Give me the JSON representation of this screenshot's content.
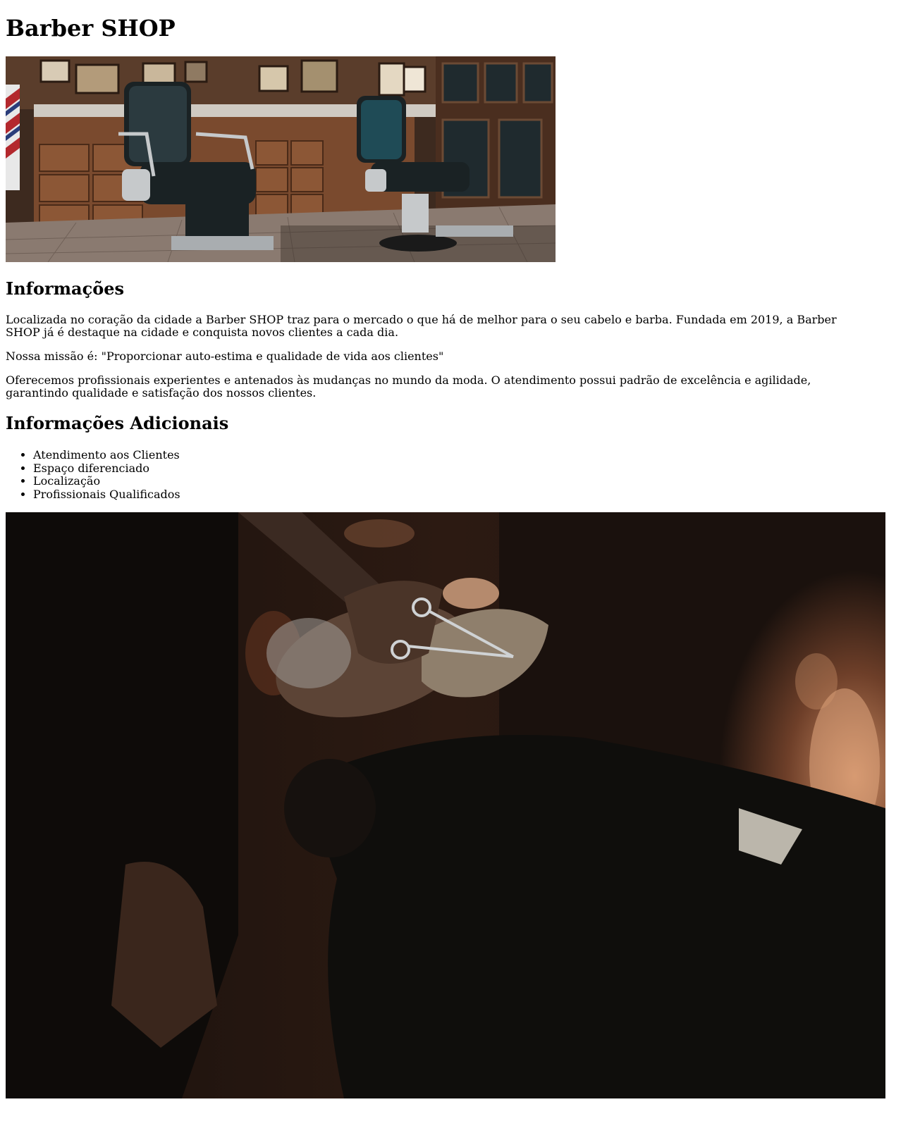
{
  "page": {
    "title": "Barber SHOP"
  },
  "hero_image": {
    "description_icon": "barbershop-interior-photo"
  },
  "info": {
    "heading": "Informações",
    "paragraph_1": "Localizada no coração da cidade a Barber SHOP traz para o mercado o que há de melhor para o seu cabelo e barba. Fundada em 2019, a Barber SHOP já é destaque na cidade e conquista novos clientes a cada dia.",
    "paragraph_2": "Nossa missão é: \"Proporcionar auto-estima e qualidade de vida aos clientes\"",
    "paragraph_3": "Oferecemos profissionais experientes e antenados às mudanças no mundo da moda. O atendimento possui padrão de excelência e agilidade, garantindo qualidade e satisfação dos nossos clientes."
  },
  "additional": {
    "heading": "Informações Adicionais",
    "items": [
      "Atendimento aos Clientes",
      "Espaço diferenciado",
      "Localização",
      "Profissionais Qualificados"
    ]
  },
  "second_image": {
    "description_icon": "beard-trim-photo"
  },
  "colors": {
    "text": "#000000",
    "background": "#ffffff"
  }
}
